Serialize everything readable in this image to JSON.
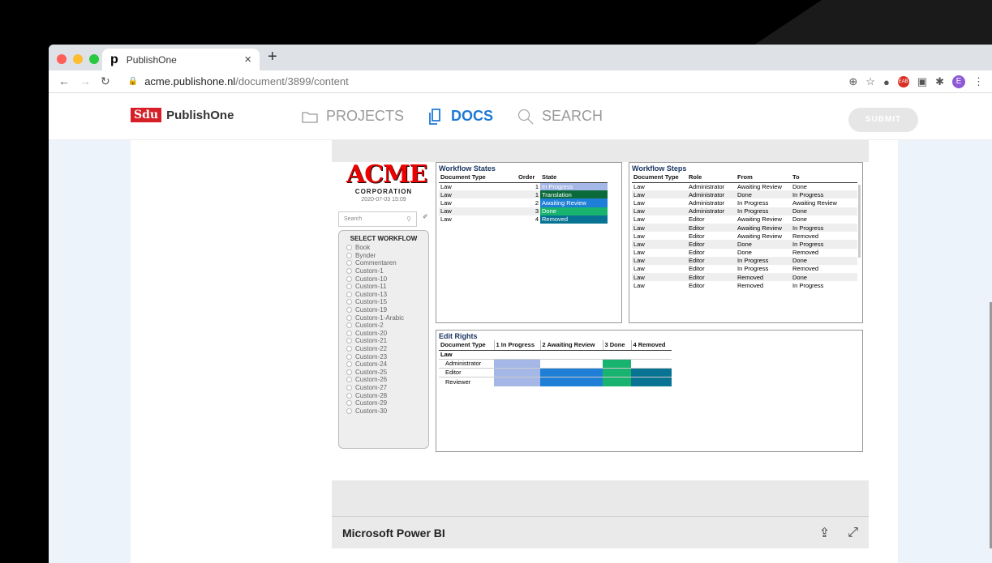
{
  "browser": {
    "tab_title": "PublishOne",
    "tab_favicon": "p",
    "close": "×",
    "new_tab": "+",
    "url_host": "acme.publishone.nl",
    "url_path": "/document/3899/content",
    "profile_initial": "E"
  },
  "app": {
    "logo_brand": "Sdu",
    "logo_name": "PublishOne",
    "nav": [
      {
        "label": "PROJECTS",
        "icon": "folder-icon",
        "active": false
      },
      {
        "label": "DOCS",
        "icon": "docs-icon",
        "active": true
      },
      {
        "label": "SEARCH",
        "icon": "search-icon",
        "active": false
      }
    ],
    "submit_label": "SUBMIT"
  },
  "report": {
    "logo_text": "ACME",
    "logo_sub": "CORPORATION",
    "date": "2020-07-03 15:09",
    "search_placeholder": "Search",
    "workflow_header": "SELECT WORKFLOW",
    "workflows": [
      "Book",
      "Bynder",
      "Commentaren",
      "Custom-1",
      "Custom-10",
      "Custom-11",
      "Custom-13",
      "Custom-15",
      "Custom-19",
      "Custom-1-Arabic",
      "Custom-2",
      "Custom-20",
      "Custom-21",
      "Custom-22",
      "Custom-23",
      "Custom-24",
      "Custom-25",
      "Custom-26",
      "Custom-27",
      "Custom-28",
      "Custom-29",
      "Custom-30"
    ],
    "states": {
      "title": "Workflow States",
      "columns": [
        "Document Type",
        "Order",
        "State"
      ],
      "rows": [
        {
          "type": "Law",
          "order": "1",
          "state": "In Progress",
          "color": "#a4b7e6",
          "text": "#ffffff"
        },
        {
          "type": "Law",
          "order": "1",
          "state": "Translation",
          "color": "#0b6a3a",
          "text": "#ffffff"
        },
        {
          "type": "Law",
          "order": "2",
          "state": "Awaiting Review",
          "color": "#1f7fd7",
          "text": "#ffffff"
        },
        {
          "type": "Law",
          "order": "3",
          "state": "Done",
          "color": "#18b36f",
          "text": "#ffffff"
        },
        {
          "type": "Law",
          "order": "4",
          "state": "Removed",
          "color": "#087392",
          "text": "#ffffff"
        }
      ]
    },
    "steps": {
      "title": "Workflow Steps",
      "columns": [
        "Document Type",
        "Role",
        "From",
        "To"
      ],
      "rows": [
        [
          "Law",
          "Administrator",
          "Awaiting Review",
          "Done"
        ],
        [
          "Law",
          "Administrator",
          "Done",
          "In Progress"
        ],
        [
          "Law",
          "Administrator",
          "In Progress",
          "Awaiting Review"
        ],
        [
          "Law",
          "Administrator",
          "In Progress",
          "Done"
        ],
        [
          "Law",
          "Editor",
          "Awaiting Review",
          "Done"
        ],
        [
          "Law",
          "Editor",
          "Awaiting Review",
          "In Progress"
        ],
        [
          "Law",
          "Editor",
          "Awaiting Review",
          "Removed"
        ],
        [
          "Law",
          "Editor",
          "Done",
          "In Progress"
        ],
        [
          "Law",
          "Editor",
          "Done",
          "Removed"
        ],
        [
          "Law",
          "Editor",
          "In Progress",
          "Done"
        ],
        [
          "Law",
          "Editor",
          "In Progress",
          "Removed"
        ],
        [
          "Law",
          "Editor",
          "Removed",
          "Done"
        ],
        [
          "Law",
          "Editor",
          "Removed",
          "In Progress"
        ]
      ]
    },
    "rights": {
      "title": "Edit Rights",
      "columns": [
        "Document Type",
        "1 In Progress",
        "2 Awaiting Review",
        "3 Done",
        "4 Removed"
      ],
      "group": "Law",
      "roles": [
        {
          "name": "Administrator",
          "cells": [
            "#a4b7e6",
            "",
            "#18b36f",
            ""
          ]
        },
        {
          "name": "Editor",
          "cells": [
            "#a4b7e6",
            "#1f7fd7",
            "#18b36f",
            "#087392"
          ]
        },
        {
          "name": "Reviewer",
          "cells": [
            "#a4b7e6",
            "#1f7fd7",
            "#18b36f",
            "#087392"
          ]
        }
      ]
    },
    "footer_title": "Microsoft Power BI"
  }
}
